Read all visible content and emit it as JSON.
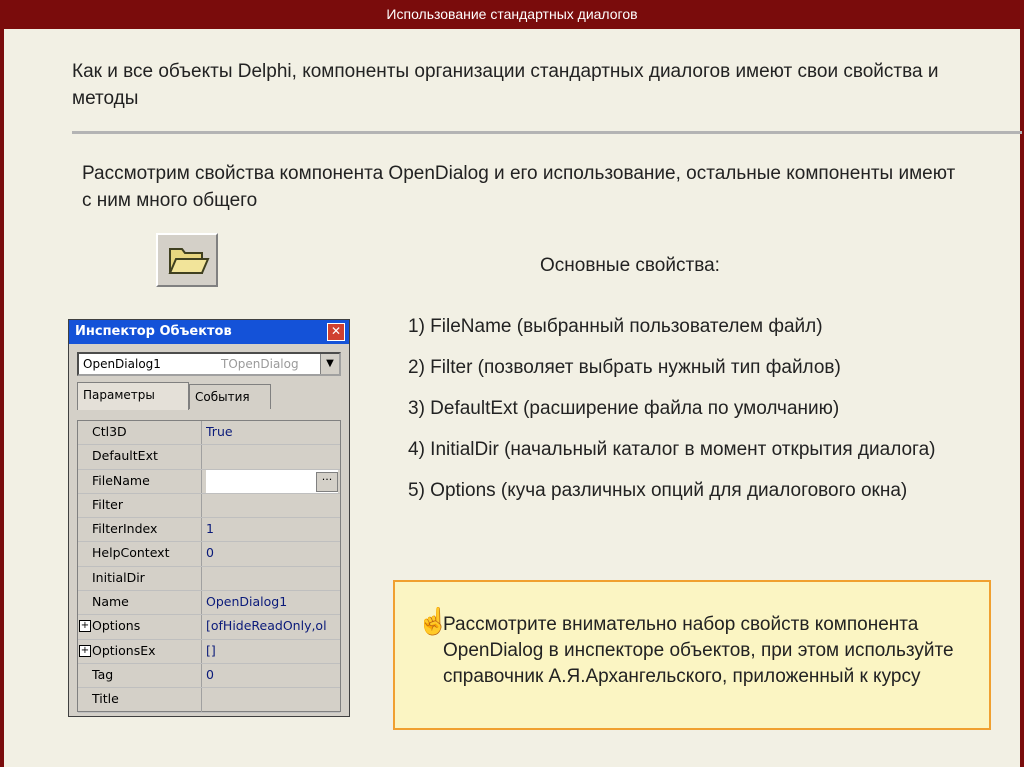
{
  "header": {
    "title": "Использование стандартных диалогов"
  },
  "intro": {
    "line1": "Как и все объекты Delphi, компоненты организации стандартных диалогов имеют свои свойства и методы",
    "line2": "Рассмотрим свойства компонента OpenDialog и его использование, остальные компоненты имеют с ним много общего"
  },
  "folder_icon": "open-folder-icon",
  "properties": {
    "title": "Основные свойства:",
    "items": [
      "1)  FileName (выбранный пользователем файл)",
      "2) Filter (позволяет выбрать нужный тип файлов)",
      "3) DefaultExt (расширение файла по умолчанию)",
      "4) InitialDir (начальный каталог в момент открытия диалога)",
      "5) Options (куча различных опций для диалогового окна)"
    ]
  },
  "note": {
    "icon": "pointing-hand-icon",
    "text": "Рассмотрите внимательно набор свойств компонента OpenDialog в инспекторе объектов, при этом используйте справочник А.Я.Архангельского, приложенный к курсу"
  },
  "inspector": {
    "title": "Инспектор Объектов",
    "object": "OpenDialog1",
    "class": "TOpenDialog",
    "tabs": [
      "Параметры",
      "События"
    ],
    "rows": [
      {
        "name": "Ctl3D",
        "value": "True"
      },
      {
        "name": "DefaultExt",
        "value": ""
      },
      {
        "name": "FileName",
        "value": ""
      },
      {
        "name": "Filter",
        "value": ""
      },
      {
        "name": "FilterIndex",
        "value": "1"
      },
      {
        "name": "HelpContext",
        "value": "0"
      },
      {
        "name": "InitialDir",
        "value": ""
      },
      {
        "name": "Name",
        "value": "OpenDialog1"
      },
      {
        "name": "Options",
        "value": "[ofHideReadOnly,ol"
      },
      {
        "name": "OptionsEx",
        "value": "[]"
      },
      {
        "name": "Tag",
        "value": "0"
      },
      {
        "name": "Title",
        "value": ""
      }
    ]
  },
  "colors": {
    "header_bg": "#7a0c0c",
    "note_bg": "#fbf5c3",
    "note_border": "#f0a030"
  }
}
